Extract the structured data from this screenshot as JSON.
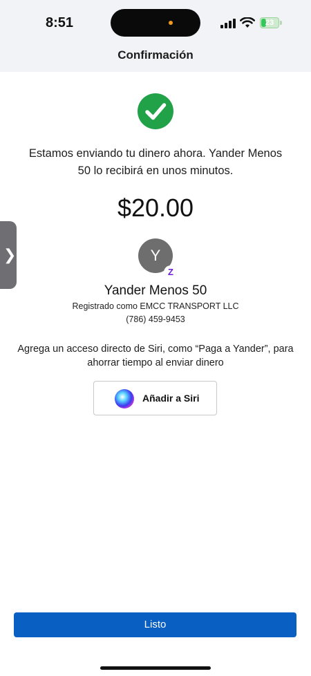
{
  "status_bar": {
    "time": "8:51",
    "battery": "23"
  },
  "header": {
    "title": "Confirmación"
  },
  "confirmation": {
    "message": "Estamos enviando tu dinero ahora. Yander Menos 50 lo recibirá en unos minutos.",
    "amount": "$20.00"
  },
  "recipient": {
    "initial": "Y",
    "badge": "Z",
    "name": "Yander Menos 50",
    "registered_as": "Registrado como EMCC TRANSPORT LLC",
    "phone": "(786) 459-9453"
  },
  "siri": {
    "hint": "Agrega un acceso directo de Siri, como “Paga a Yander”, para ahorrar tiempo al enviar dinero",
    "button_label": "Añadir a Siri"
  },
  "footer": {
    "done_label": "Listo"
  },
  "side_handle": {
    "glyph": "❯"
  },
  "colors": {
    "success_green": "#21a148",
    "primary_blue": "#0a5fc2",
    "zelle_purple": "#6d1ed4",
    "header_bg": "#f2f3f7"
  },
  "icons": {
    "check": "check-circle-icon",
    "signal": "cellular-signal-icon",
    "wifi": "wifi-icon",
    "battery": "battery-icon",
    "siri": "siri-icon",
    "zelle": "zelle-icon",
    "chevron": "chevron-right-icon"
  }
}
